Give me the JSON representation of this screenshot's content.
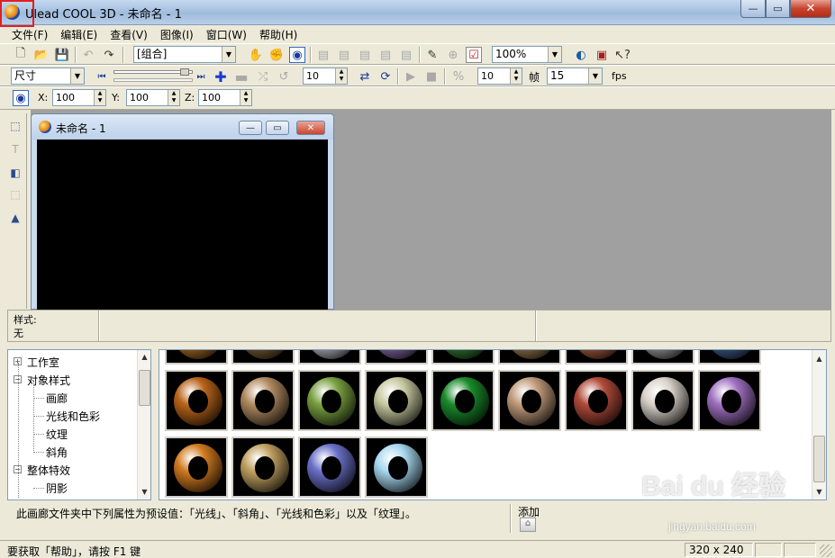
{
  "window": {
    "title": "Ulead COOL 3D - 未命名 - 1",
    "controls": {
      "minimize": "—",
      "maximize": "▭",
      "close": "✕"
    }
  },
  "menu": [
    "文件(F)",
    "编辑(E)",
    "查看(V)",
    "图像(I)",
    "窗口(W)",
    "帮助(H)"
  ],
  "toolbar1": {
    "object_combo": "[组合]",
    "zoom_combo": "100%"
  },
  "toolbar2": {
    "mode_combo": "尺寸",
    "frame_spin": "10",
    "step_spin": "10",
    "frame_label": "帧",
    "fps_combo": "15",
    "fps_label": "fps"
  },
  "toolbar3": {
    "x_label": "X:",
    "x_value": "100",
    "y_label": "Y:",
    "y_value": "100",
    "z_label": "Z:",
    "z_value": "100"
  },
  "document": {
    "title": "未命名 - 1",
    "canvas_color": "#000000"
  },
  "style_bar": {
    "label": "样式:",
    "value": "无"
  },
  "tree": [
    {
      "label": "工作室",
      "toggle": "+",
      "level": 0
    },
    {
      "label": "对象样式",
      "toggle": "−",
      "level": 0
    },
    {
      "label": "画廊",
      "level": 1
    },
    {
      "label": "光线和色彩",
      "level": 1
    },
    {
      "label": "纹理",
      "level": 1
    },
    {
      "label": "斜角",
      "level": 1
    },
    {
      "label": "整体特效",
      "toggle": "−",
      "level": 0
    },
    {
      "label": "阴影",
      "level": 1
    }
  ],
  "gallery": {
    "partial_row_colors": [
      "#c07a2a",
      "#8a6a40",
      "#d0d0e0",
      "#9a7ac0",
      "#3a8a3a",
      "#b08a5a",
      "#c06a4a",
      "#b0b0b0",
      "#4a6aa0"
    ],
    "rows": [
      [
        "#b8641a",
        "#b08a60",
        "#7aa040",
        "#c8c8a0",
        "#1a8a2a",
        "#c09a7a",
        "#b04a3a",
        "#d8d0c8",
        "#a070c0"
      ],
      [
        "#d07a20",
        "#c0a060",
        "#6a70c8",
        "#a8d8f0"
      ]
    ]
  },
  "description": {
    "text": "此画廊文件夹中下列属性为预设值：「光线」、「斜角」、「光线和色彩」以及「纹理」。",
    "add_label": "添加"
  },
  "statusbar": {
    "help_text": "要获取「帮助」，请按 F1 键",
    "canvas_size": "320 x 240"
  },
  "watermark": {
    "brand": "Bai du 经验",
    "url": "jingyan.baidu.com"
  },
  "colors": {
    "chrome": "#ece9d8",
    "workspace": "#a0a0a0",
    "highlight_box": "#e02020"
  }
}
